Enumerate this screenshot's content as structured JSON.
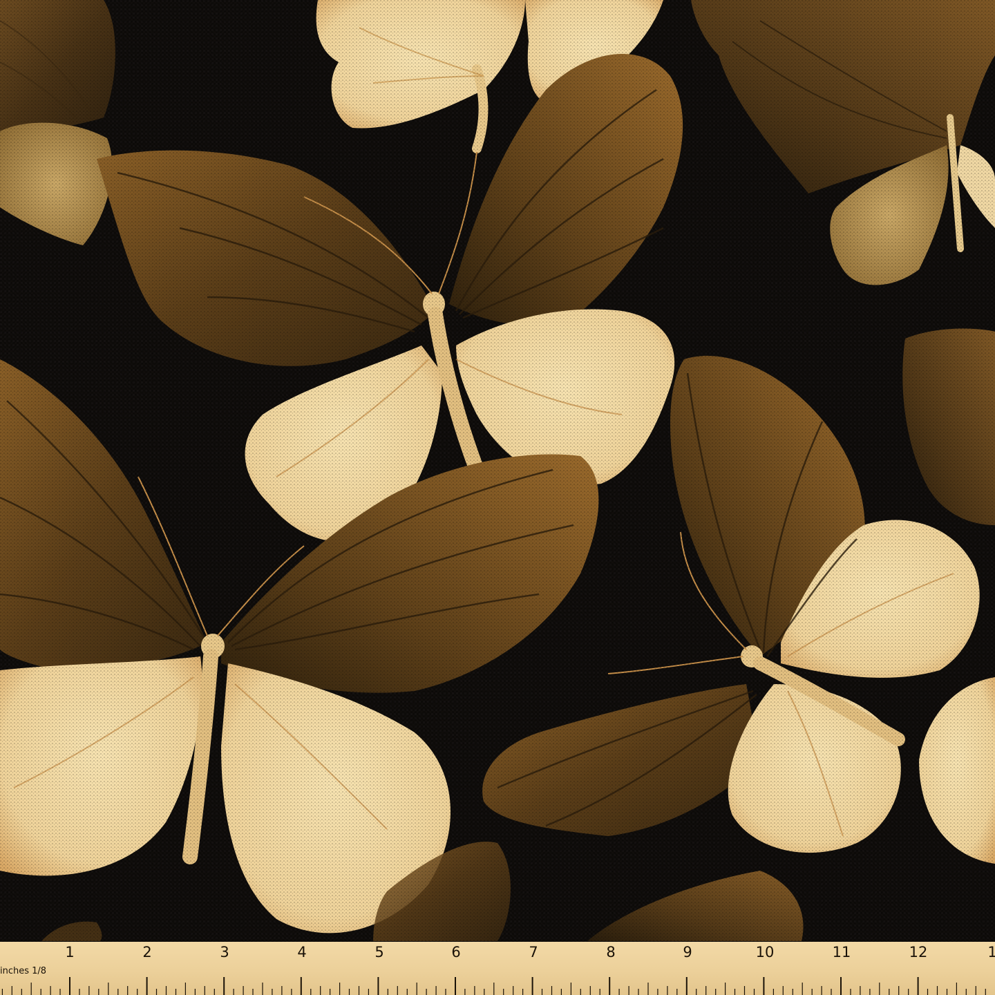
{
  "image": {
    "background_color": "#0d0b09",
    "wing_colors": [
      "#4a3214",
      "#6b4a1f",
      "#8a5f27",
      "#b07a3a"
    ],
    "light_wing_colors": [
      "#f2dba6",
      "#e8c88a",
      "#d9b06e"
    ]
  },
  "ruler": {
    "caption": "inches 1/8",
    "numbers": [
      "1",
      "2",
      "3",
      "4",
      "5",
      "6",
      "7",
      "8",
      "9",
      "10",
      "11",
      "12",
      "1"
    ],
    "color": "#ecd09a"
  }
}
